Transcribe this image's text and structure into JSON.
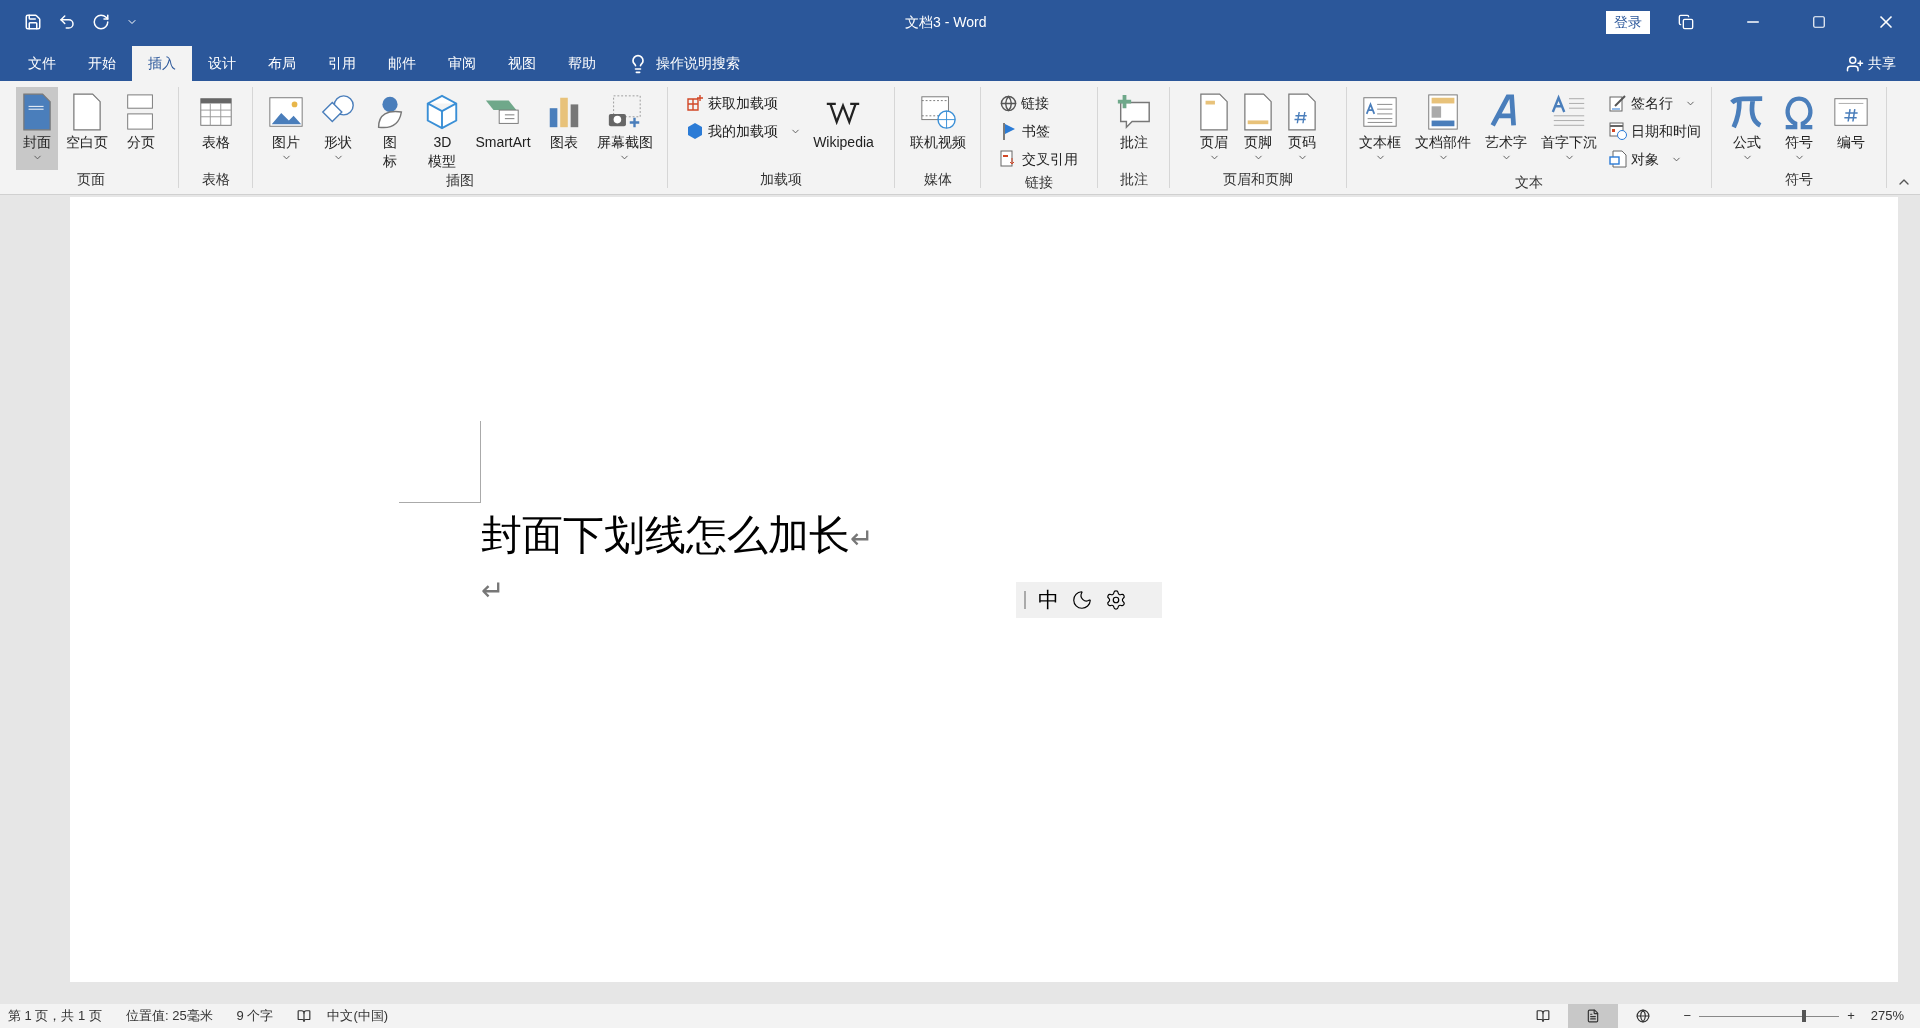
{
  "window": {
    "title": "文档3  -  Word",
    "sign_in": "登录",
    "share": "共享"
  },
  "tabs": [
    {
      "label": "文件",
      "selected": false
    },
    {
      "label": "开始",
      "selected": false
    },
    {
      "label": "插入",
      "selected": true
    },
    {
      "label": "设计",
      "selected": false
    },
    {
      "label": "布局",
      "selected": false
    },
    {
      "label": "引用",
      "selected": false
    },
    {
      "label": "邮件",
      "selected": false
    },
    {
      "label": "审阅",
      "selected": false
    },
    {
      "label": "视图",
      "selected": false
    },
    {
      "label": "帮助",
      "selected": false
    }
  ],
  "tell_me": "操作说明搜索",
  "ribbon_groups": [
    {
      "label": "页面",
      "items": [
        {
          "kind": "large",
          "label": "封面",
          "caret": true,
          "highlighted": true
        },
        {
          "kind": "large",
          "label": "空白页",
          "caret": false,
          "highlighted": false
        },
        {
          "kind": "large",
          "label": "分页",
          "caret": false,
          "highlighted": false
        }
      ]
    },
    {
      "label": "表格",
      "items": [
        {
          "kind": "large",
          "label": "表格",
          "caret": false,
          "highlighted": false
        }
      ]
    },
    {
      "label": "插图",
      "items": [
        {
          "kind": "large",
          "label": "图片",
          "caret": true,
          "highlighted": false
        },
        {
          "kind": "large",
          "label": "形状",
          "caret": true,
          "highlighted": false
        },
        {
          "kind": "large",
          "lines": [
            "图",
            "标"
          ],
          "caret": false,
          "highlighted": false
        },
        {
          "kind": "large",
          "lines": [
            "3D",
            "模型"
          ],
          "caret": false,
          "highlighted": false
        },
        {
          "kind": "large",
          "label": "SmartArt",
          "caret": false,
          "highlighted": false
        },
        {
          "kind": "large",
          "label": "图表",
          "caret": false,
          "highlighted": false
        },
        {
          "kind": "large",
          "label": "屏幕截图",
          "caret": true,
          "highlighted": false
        }
      ]
    },
    {
      "label": "加载项",
      "items": [
        {
          "kind": "small",
          "label": "获取加载项",
          "caret": false,
          "highlighted": false
        },
        {
          "kind": "small",
          "label": "我的加载项",
          "caret": true,
          "highlighted": false
        },
        {
          "kind": "large",
          "label": "Wikipedia",
          "caret": false,
          "highlighted": false
        }
      ]
    },
    {
      "label": "媒体",
      "items": [
        {
          "kind": "large",
          "label": "联机视频",
          "caret": false,
          "highlighted": false
        }
      ]
    },
    {
      "label": "链接",
      "items": [
        {
          "kind": "small",
          "label": "链接",
          "caret": false,
          "highlighted": false
        },
        {
          "kind": "small",
          "label": "书签",
          "caret": false,
          "highlighted": false
        },
        {
          "kind": "small",
          "label": "交叉引用",
          "caret": false,
          "highlighted": false
        }
      ]
    },
    {
      "label": "批注",
      "items": [
        {
          "kind": "large",
          "label": "批注",
          "caret": false,
          "highlighted": false
        }
      ]
    },
    {
      "label": "页眉和页脚",
      "items": [
        {
          "kind": "large",
          "label": "页眉",
          "caret": true,
          "highlighted": false
        },
        {
          "kind": "large",
          "label": "页脚",
          "caret": true,
          "highlighted": false
        },
        {
          "kind": "large",
          "label": "页码",
          "caret": true,
          "highlighted": false
        }
      ]
    },
    {
      "label": "文本",
      "items": [
        {
          "kind": "large",
          "label": "文本框",
          "caret": true,
          "highlighted": false
        },
        {
          "kind": "large",
          "label": "文档部件",
          "caret": true,
          "highlighted": false
        },
        {
          "kind": "large",
          "label": "艺术字",
          "caret": true,
          "highlighted": false
        },
        {
          "kind": "large",
          "label": "首字下沉",
          "caret": true,
          "highlighted": false
        },
        {
          "kind": "small",
          "label": "签名行",
          "caret": true,
          "highlighted": false
        },
        {
          "kind": "small",
          "label": "日期和时间",
          "caret": false,
          "highlighted": false
        },
        {
          "kind": "small",
          "label": "对象",
          "caret": true,
          "highlighted": false
        }
      ]
    },
    {
      "label": "符号",
      "items": [
        {
          "kind": "large",
          "label": "公式",
          "caret": true,
          "highlighted": false
        },
        {
          "kind": "large",
          "label": "符号",
          "caret": true,
          "highlighted": false
        },
        {
          "kind": "large",
          "label": "编号",
          "caret": false,
          "highlighted": false
        }
      ]
    }
  ],
  "document": {
    "paragraphs": [
      {
        "text": "封面下划线怎么加长",
        "mark": "↵"
      },
      {
        "mark": "↵"
      }
    ]
  },
  "ime_toolbar": {
    "mode": "中"
  },
  "status_bar": {
    "items": [
      "第 1 页，共 1 页",
      "位置值: 25毫米",
      "9 个字"
    ],
    "language": "中文(中国)",
    "views": [
      {
        "selected": false
      },
      {
        "selected": true
      },
      {
        "selected": false
      }
    ],
    "zoom": {
      "minus": "−",
      "plus": "+",
      "level": 0.75,
      "reading": "275%"
    }
  }
}
